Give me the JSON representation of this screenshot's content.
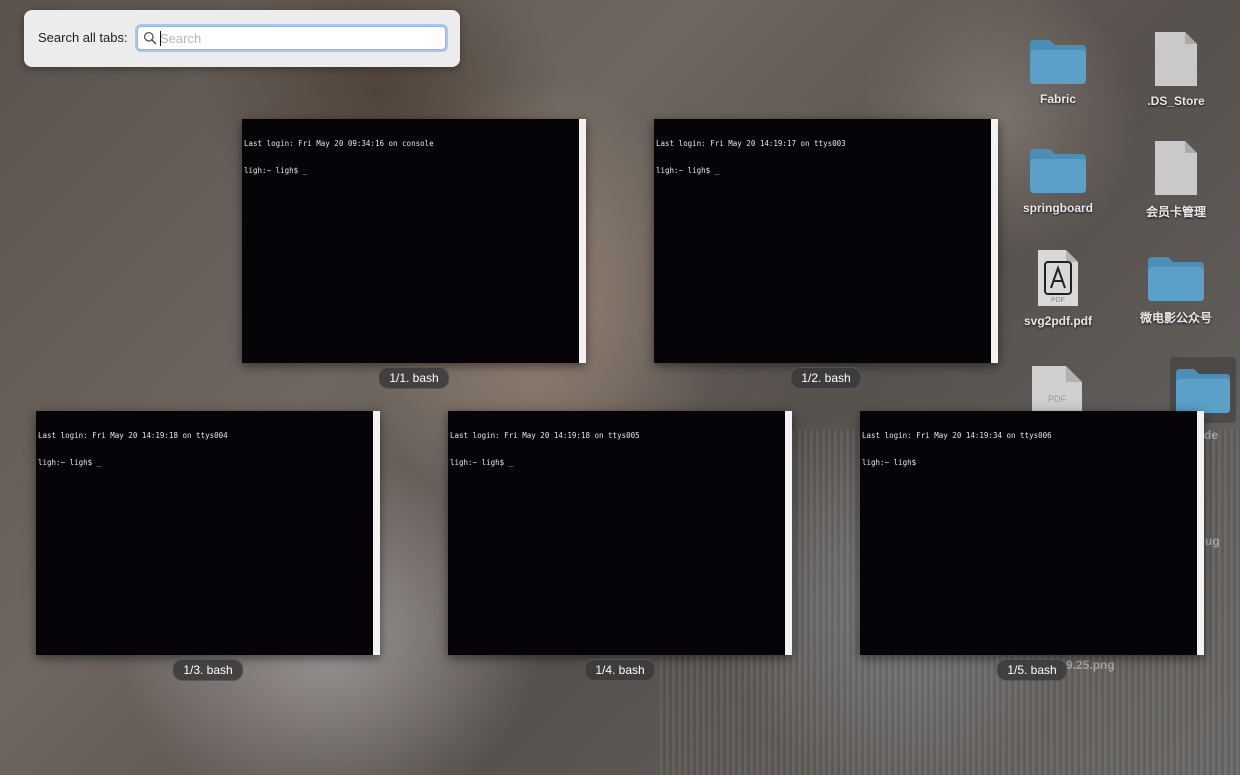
{
  "search": {
    "label": "Search all tabs:",
    "placeholder": "Search",
    "value": ""
  },
  "tabs": [
    {
      "label": "1/1. bash",
      "lines": [
        "Last login: Fri May 20 09:34:16 on console",
        "ligh:~ ligh$ _"
      ]
    },
    {
      "label": "1/2. bash",
      "lines": [
        "Last login: Fri May 20 14:19:17 on ttys003",
        "ligh:~ ligh$ _"
      ]
    },
    {
      "label": "1/3. bash",
      "lines": [
        "Last login: Fri May 20 14:19:18 on ttys004",
        "ligh:~ ligh$ _"
      ]
    },
    {
      "label": "1/4. bash",
      "lines": [
        "Last login: Fri May 20 14:19:18 on ttys005",
        "ligh:~ ligh$ _"
      ]
    },
    {
      "label": "1/5. bash",
      "lines": [
        "Last login: Fri May 20 14:19:34 on ttys006",
        "ligh:~ ligh$"
      ]
    }
  ],
  "desktop": {
    "items": [
      {
        "name": "Fabric",
        "icon": "folder-icon"
      },
      {
        "name": ".DS_Store",
        "icon": "document-icon"
      },
      {
        "name": "springboard",
        "icon": "folder-icon"
      },
      {
        "name": "会员卡管理",
        "icon": "document-icon"
      },
      {
        "name": "svg2pdf.pdf",
        "icon": "pdf-icon"
      },
      {
        "name": "微电影公众号",
        "icon": "folder-icon"
      }
    ],
    "partial": {
      "pdf_badge": "PDF",
      "item_fragment": "de",
      "item_fragment_2": "ug",
      "png_fragment": "9.25.png"
    }
  },
  "colors": {
    "terminal_bg": "#060409",
    "terminal_text": "#e6e6e6",
    "folder_blue": "#5aa0c8",
    "label_pill": "#3a3a3a",
    "focus_ring": "#a9c9f3"
  }
}
